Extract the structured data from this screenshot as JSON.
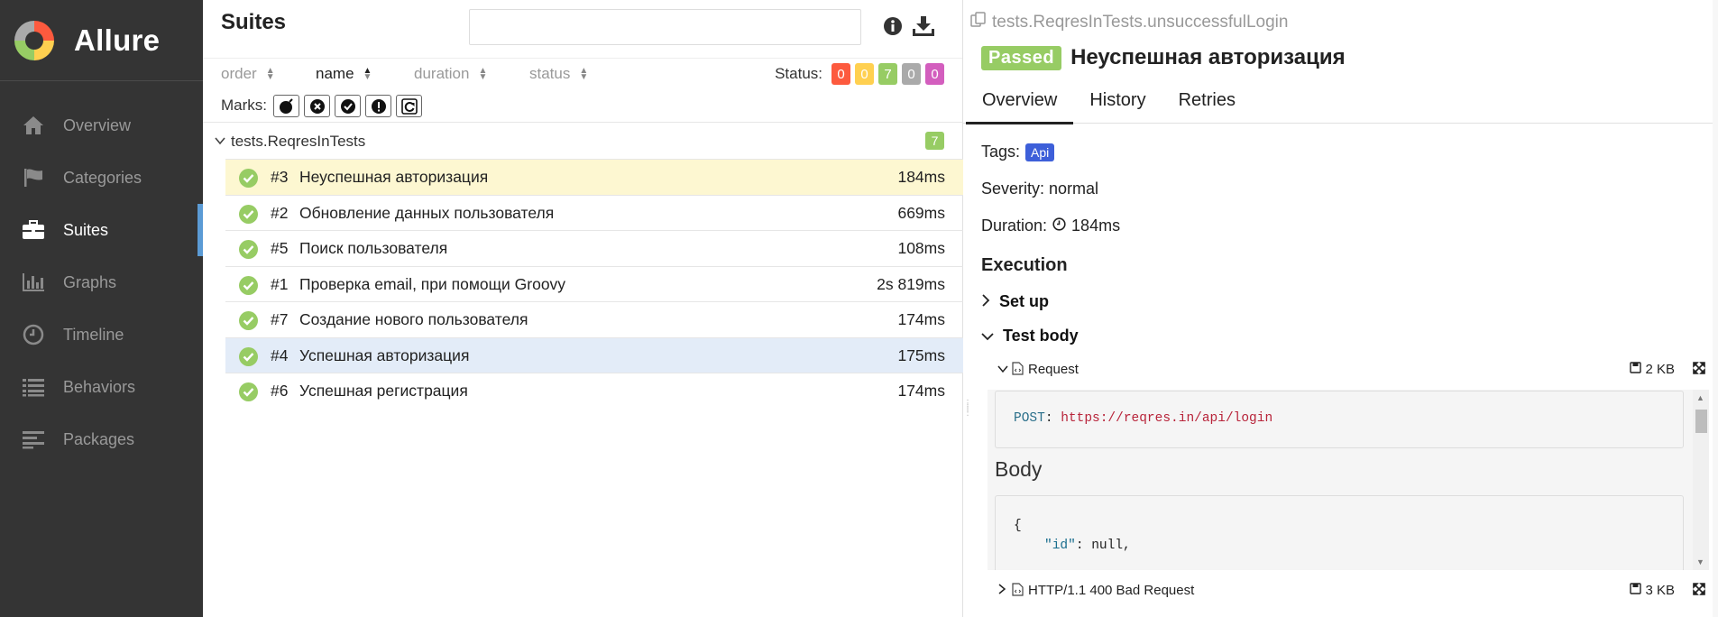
{
  "sidebar": {
    "brand": "Allure",
    "items": [
      {
        "label": "Overview",
        "icon": "home-icon"
      },
      {
        "label": "Categories",
        "icon": "flag-icon"
      },
      {
        "label": "Suites",
        "icon": "briefcase-icon",
        "active": true
      },
      {
        "label": "Graphs",
        "icon": "bar-chart-icon"
      },
      {
        "label": "Timeline",
        "icon": "clock-icon"
      },
      {
        "label": "Behaviors",
        "icon": "list-icon"
      },
      {
        "label": "Packages",
        "icon": "align-left-icon"
      }
    ]
  },
  "suites": {
    "title": "Suites",
    "search_value": "",
    "sort": {
      "order": "order",
      "name": "name",
      "duration": "duration",
      "status": "status",
      "active": "name"
    },
    "status_label": "Status:",
    "status_counts": [
      {
        "value": "0",
        "color": "#fd5a3e"
      },
      {
        "value": "0",
        "color": "#ffd050"
      },
      {
        "value": "7",
        "color": "#97cc64"
      },
      {
        "value": "0",
        "color": "#aaaaaa"
      },
      {
        "value": "0",
        "color": "#d35ebe"
      }
    ],
    "marks_label": "Marks:",
    "marks": [
      "bomb-icon",
      "times-circle-icon",
      "check-circle-icon",
      "exclamation-icon",
      "refresh-icon"
    ],
    "group": {
      "name": "tests.ReqresInTests",
      "count": "7"
    },
    "tests": [
      {
        "num": "#3",
        "name": "Неуспешная авторизация",
        "duration": "184ms",
        "highlight": "yellow"
      },
      {
        "num": "#2",
        "name": "Обновление данных пользователя",
        "duration": "669ms",
        "highlight": ""
      },
      {
        "num": "#5",
        "name": "Поиск пользователя",
        "duration": "108ms",
        "highlight": ""
      },
      {
        "num": "#1",
        "name": "Проверка email, при помощи Groovy",
        "duration": "2s 819ms",
        "highlight": ""
      },
      {
        "num": "#7",
        "name": "Создание нового пользователя",
        "duration": "174ms",
        "highlight": ""
      },
      {
        "num": "#4",
        "name": "Успешная авторизация",
        "duration": "175ms",
        "highlight": "blue"
      },
      {
        "num": "#6",
        "name": "Успешная регистрация",
        "duration": "174ms",
        "highlight": ""
      }
    ]
  },
  "detail": {
    "breadcrumb": "tests.ReqresInTests.unsuccessfulLogin",
    "status": "Passed",
    "title": "Неуспешная авторизация",
    "tabs": [
      "Overview",
      "History",
      "Retries"
    ],
    "tags_label": "Tags:",
    "tag": "Api",
    "severity": "Severity: normal",
    "duration_label": "Duration:",
    "duration": "184ms",
    "execution": "Execution",
    "setup": "Set up",
    "test_body": "Test body",
    "request_label": "Request",
    "request_size": "2 KB",
    "method": "POST",
    "colon": ":",
    "url": "https://reqres.in/api/login",
    "body_heading": "Body",
    "body_line1": "{",
    "body_key": "\"id\"",
    "body_val": ": null,",
    "response_label": "HTTP/1.1 400 Bad Request",
    "response_size": "3 KB"
  }
}
